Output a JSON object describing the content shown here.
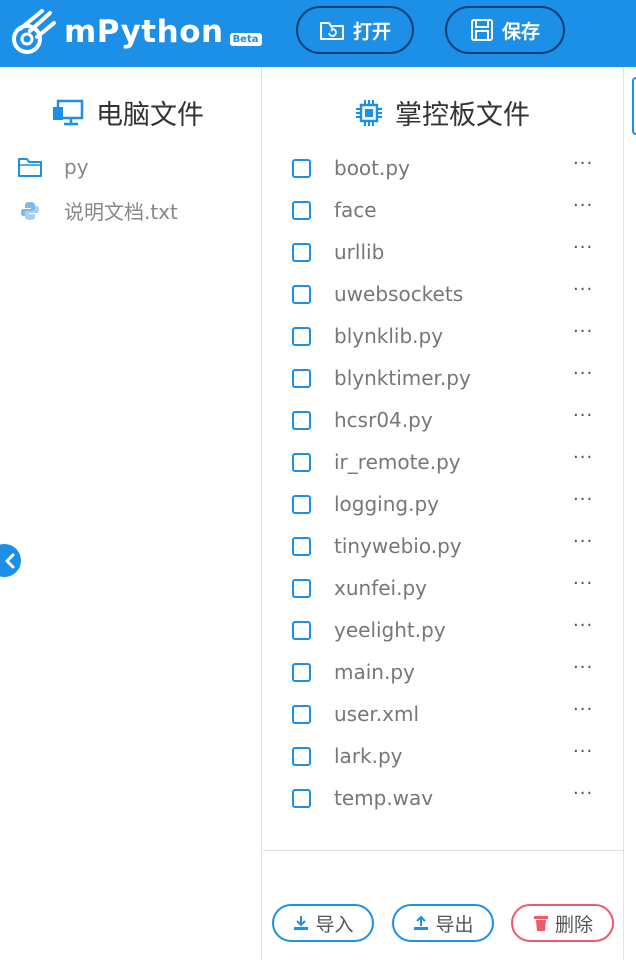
{
  "app": {
    "name": "mPython",
    "badge": "Beta",
    "brand_color": "#1c8fe6"
  },
  "toolbar": {
    "open_label": "打开",
    "save_label": "保存"
  },
  "computer_files": {
    "title": "电脑文件",
    "items": [
      {
        "name": "py",
        "icon": "folder-icon"
      },
      {
        "name": "说明文档.txt",
        "icon": "python-icon"
      }
    ]
  },
  "board_files": {
    "title": "掌控板文件",
    "items": [
      {
        "name": "boot.py"
      },
      {
        "name": "face"
      },
      {
        "name": "urllib"
      },
      {
        "name": "uwebsockets"
      },
      {
        "name": "blynklib.py"
      },
      {
        "name": "blynktimer.py"
      },
      {
        "name": "hcsr04.py"
      },
      {
        "name": "ir_remote.py"
      },
      {
        "name": "logging.py"
      },
      {
        "name": "tinywebio.py"
      },
      {
        "name": "xunfei.py"
      },
      {
        "name": "yeelight.py"
      },
      {
        "name": "main.py"
      },
      {
        "name": "user.xml"
      },
      {
        "name": "lark.py"
      },
      {
        "name": "temp.wav"
      }
    ],
    "more_label": "···"
  },
  "actions": {
    "import_label": "导入",
    "export_label": "导出",
    "delete_label": "删除"
  }
}
